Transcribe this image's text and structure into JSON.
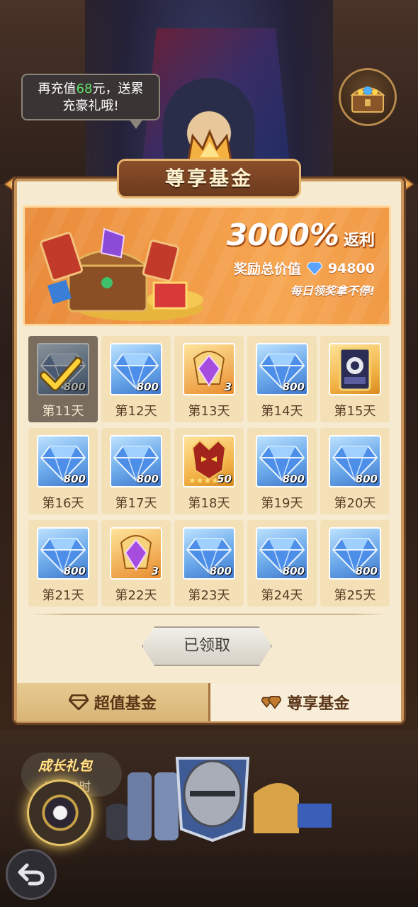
{
  "bubble": {
    "prefix": "再充值",
    "amount": "68",
    "suffix": "元，送累",
    "line2": "充豪礼哦!"
  },
  "panel": {
    "title": "尊享基金"
  },
  "promo": {
    "percent": "3000%",
    "rebate": "返利",
    "total_label": "奖励总价值",
    "total_value": "94800",
    "daily": "每日领奖拿不停!"
  },
  "rewards": [
    {
      "day": "第11天",
      "type": "diamond",
      "count": "800",
      "claimed": true
    },
    {
      "day": "第12天",
      "type": "diamond",
      "count": "800",
      "claimed": false
    },
    {
      "day": "第13天",
      "type": "crystal",
      "count": "3",
      "claimed": false
    },
    {
      "day": "第14天",
      "type": "diamond",
      "count": "800",
      "claimed": false
    },
    {
      "day": "第15天",
      "type": "card",
      "count": "",
      "claimed": false
    },
    {
      "day": "第16天",
      "type": "diamond",
      "count": "800",
      "claimed": false
    },
    {
      "day": "第17天",
      "type": "diamond",
      "count": "800",
      "claimed": false
    },
    {
      "day": "第18天",
      "type": "hero-mask",
      "count": "50",
      "claimed": false
    },
    {
      "day": "第19天",
      "type": "diamond",
      "count": "800",
      "claimed": false
    },
    {
      "day": "第20天",
      "type": "diamond",
      "count": "800",
      "claimed": false
    },
    {
      "day": "第21天",
      "type": "diamond",
      "count": "800",
      "claimed": false
    },
    {
      "day": "第22天",
      "type": "crystal",
      "count": "3",
      "claimed": false
    },
    {
      "day": "第23天",
      "type": "diamond",
      "count": "800",
      "claimed": false
    },
    {
      "day": "第24天",
      "type": "diamond",
      "count": "800",
      "claimed": false
    },
    {
      "day": "第25天",
      "type": "diamond",
      "count": "800",
      "claimed": false
    }
  ],
  "claim_button": "已领取",
  "tabs": [
    {
      "label": "超值基金",
      "active": false
    },
    {
      "label": "尊享基金",
      "active": true
    }
  ],
  "growth": {
    "title": "成长礼包",
    "timer": "5天13时"
  },
  "colors": {
    "accent_green": "#5fe06a",
    "panel_bg": "#f6ead0",
    "banner_orange": "#f19a46"
  }
}
